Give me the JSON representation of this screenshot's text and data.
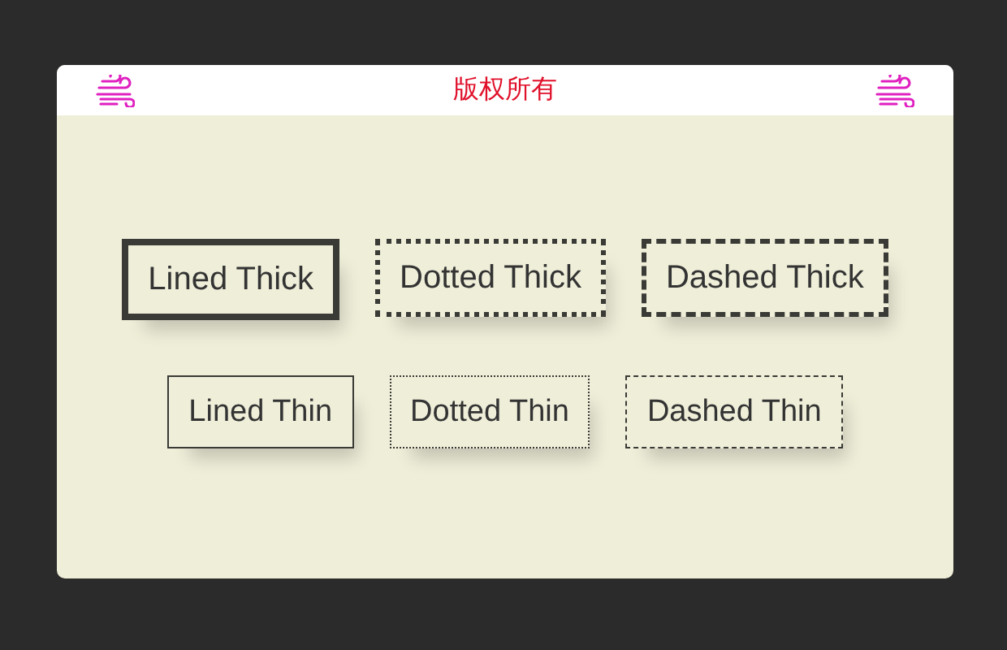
{
  "header": {
    "title": "版权所有"
  },
  "rows": [
    {
      "thick": true,
      "items": [
        {
          "label": "Lined Thick",
          "kind": "lined"
        },
        {
          "label": "Dotted Thick",
          "kind": "dotted"
        },
        {
          "label": "Dashed Thick",
          "kind": "dashed"
        }
      ]
    },
    {
      "thick": false,
      "items": [
        {
          "label": "Lined Thin",
          "kind": "lined"
        },
        {
          "label": "Dotted Thin",
          "kind": "dotted"
        },
        {
          "label": "Dashed Thin",
          "kind": "dashed"
        }
      ]
    }
  ]
}
